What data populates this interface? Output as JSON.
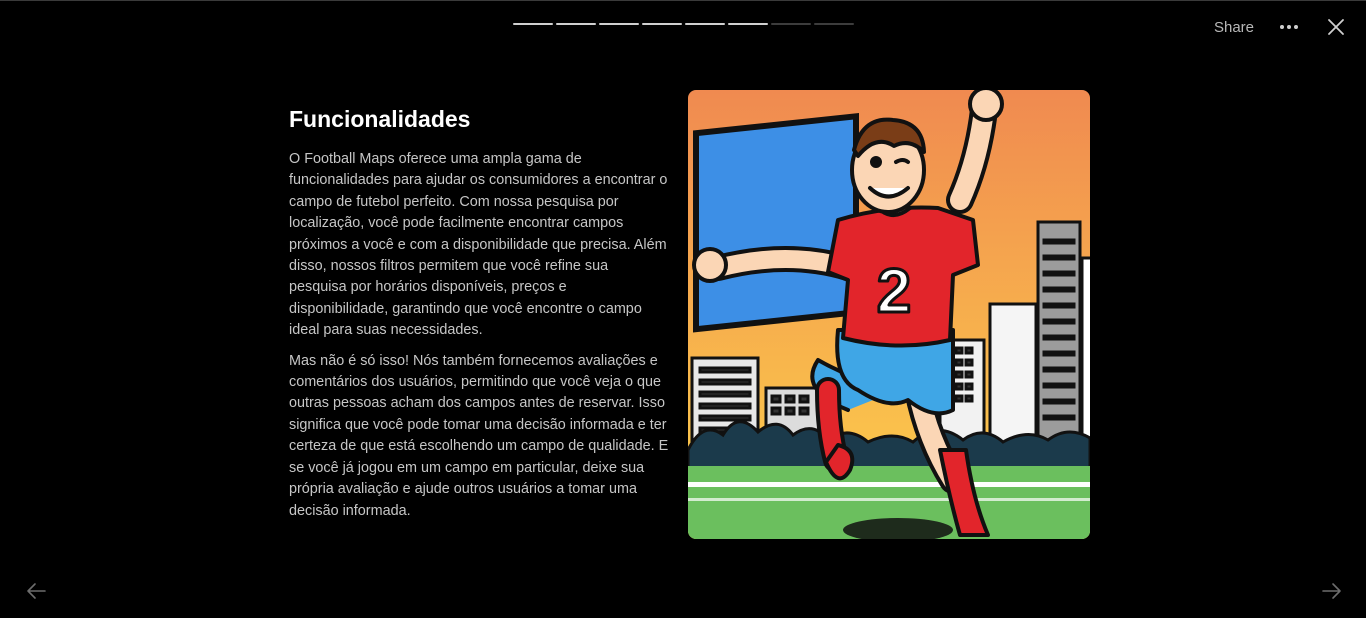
{
  "progress": {
    "total": 8,
    "completed": 6
  },
  "topbar": {
    "share_label": "Share",
    "more_icon": "more-horizontal-icon",
    "close_icon": "close-icon"
  },
  "slide": {
    "title": "Funcionalidades",
    "paragraphs": [
      "O Football Maps oferece uma ampla gama de funcionalidades para ajudar os consumidores a encontrar o campo de futebol perfeito. Com nossa pesquisa por localização, você pode facilmente encontrar campos próximos a você e com a disponibilidade que precisa. Além disso, nossos filtros permitem que você refine sua pesquisa por horários disponíveis, preços e disponibilidade, garantindo que você encontre o campo ideal para suas necessidades.",
      "Mas não é só isso! Nós também fornecemos avaliações e comentários dos usuários, permitindo que você veja o que outras pessoas acham dos campos antes de reservar. Isso significa que você pode tomar uma decisão informada e ter certeza de que está escolhendo um campo de qualidade. E se você já jogou em um campo em particular, deixe sua própria avaliação e ajude outros usuários a tomar uma decisão informada."
    ],
    "image": {
      "jersey_number": "2",
      "colors": {
        "sky_top": "#f08a50",
        "sky_bottom": "#fdd24a",
        "jersey": "#e2252b",
        "shorts": "#3fa6e6",
        "grass": "#6bbf5e",
        "billboard": "#3d8fe6"
      }
    }
  },
  "navigation": {
    "prev_icon": "arrow-left-icon",
    "next_icon": "arrow-right-icon"
  },
  "theme": {
    "background": "#000000",
    "text_primary": "#ffffff",
    "text_secondary": "#c6c6c6",
    "progress_done": "#cfcfcf",
    "progress_pending": "#3c3c3c"
  }
}
